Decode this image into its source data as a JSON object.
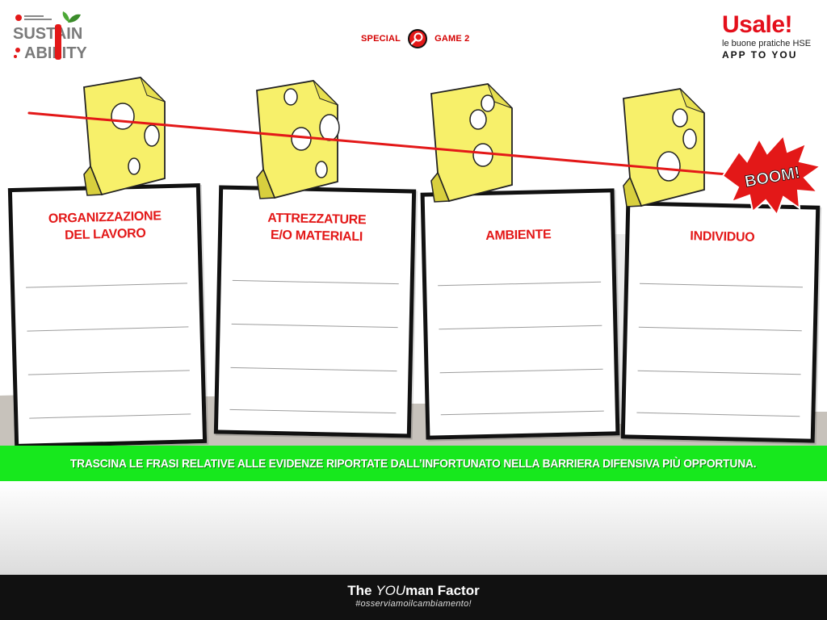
{
  "logos": {
    "left_text_1": "SUSTAIN",
    "left_text_2": "ABILITY",
    "right_title": "Usale!",
    "right_subtitle": "le buone pratiche HSE",
    "right_tagline": "APP TO YOU"
  },
  "header": {
    "left_label": "SPECIAL",
    "right_label": "GAME 2",
    "icon": "magnifier-icon"
  },
  "boom_text": "BOOM!",
  "cards": [
    {
      "title": "ORGANIZZAZIONE\nDEL LAVORO"
    },
    {
      "title": "ATTREZZATURE\nE/O MATERIALI"
    },
    {
      "title": "AMBIENTE"
    },
    {
      "title": "INDIVIDUO"
    }
  ],
  "instruction": "TRASCINA LE FRASI RELATIVE ALLE EVIDENZE RIPORTATE DALL’INFORTUNATO NELLA BARRIERA DIFENSIVA PIÙ OPPORTUNA.",
  "footer": {
    "title_prefix": "The ",
    "title_you": "YOU",
    "title_suffix": "man Factor",
    "hashtag": "#osserviamoilcambiamento!"
  },
  "colors": {
    "accent_red": "#e31818",
    "instruction_green": "#17e81d",
    "cheese_yellow": "#f7f06a",
    "footer_black": "#111111"
  }
}
